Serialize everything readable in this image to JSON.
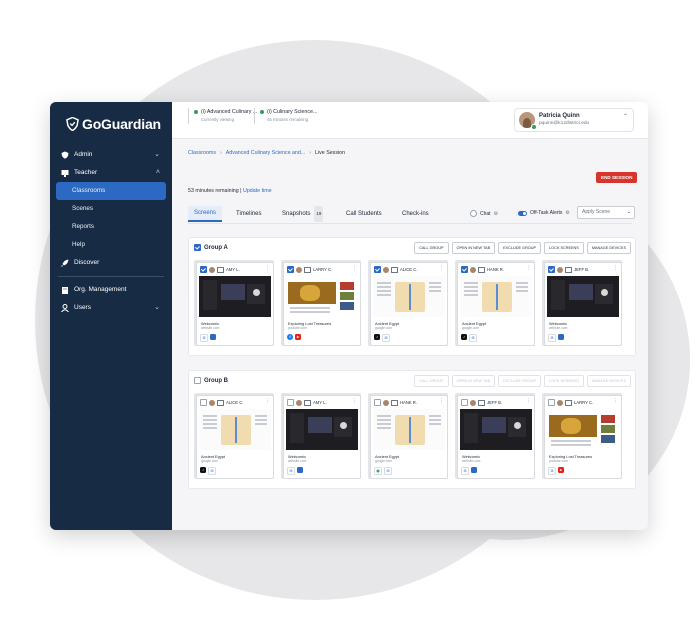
{
  "brand": {
    "logo_text": "GoGuardian"
  },
  "sidebar": {
    "items": [
      {
        "label": "Admin",
        "has_caret": true
      },
      {
        "label": "Teacher",
        "has_caret": true
      },
      {
        "label": "Classrooms",
        "active": true
      },
      {
        "label": "Scenes"
      },
      {
        "label": "Reports"
      },
      {
        "label": "Help"
      },
      {
        "label": "Discover"
      },
      {
        "label": "Org. Management"
      },
      {
        "label": "Users",
        "has_caret": true
      }
    ]
  },
  "topbar": {
    "sessions": [
      {
        "title": "(i) Advanced Culinary ...",
        "status": "Currently viewing"
      },
      {
        "title": "(i) Culinary Science...",
        "status": "45 minutes remaining"
      }
    ],
    "user": {
      "name": "Patricia Quinn",
      "email": "pquinn@k12district.edu"
    }
  },
  "breadcrumb": {
    "root": "Classrooms",
    "middle": "Advanced Culinary Science and...",
    "current": "Live Session"
  },
  "end_session_label": "END SESSION",
  "session": {
    "time_remaining": "53 minutes remaining",
    "separator": "|",
    "update_time_label": "Update time"
  },
  "view_tabs": [
    {
      "label": "Screens",
      "active": true
    },
    {
      "label": "Timelines"
    },
    {
      "label": "Snapshots",
      "count": "19"
    },
    {
      "label": "Call Students"
    },
    {
      "label": "Check-ins"
    }
  ],
  "controls": {
    "chat_label": "Chat",
    "offtask_label": "Off-Task Alerts",
    "apply_scene_placeholder": "Apply Scene"
  },
  "group_a": {
    "title": "Group A",
    "actions": [
      "CALL GROUP",
      "OPEN IN NEW TAB",
      "EXCLUDE GROUP",
      "LOCK SCREENS",
      "MANAGE DEVICES"
    ],
    "cards": [
      {
        "name": "AMY L.",
        "page_title": "Webcomic",
        "url": "website.com",
        "theme": "dark",
        "apps": [
          "google",
          "meet"
        ]
      },
      {
        "name": "LARRY C.",
        "page_title": "Exploring Lost Treasures",
        "url": "youtube.com",
        "theme": "gold",
        "apps": [
          "fb",
          "yt"
        ]
      },
      {
        "name": "ALICE C.",
        "page_title": "Ancient Egypt",
        "url": "google.com",
        "theme": "map",
        "apps": [
          "tiktok",
          "google"
        ]
      },
      {
        "name": "HANK R.",
        "page_title": "Ancient Egypt",
        "url": "google.com",
        "theme": "map",
        "apps": [
          "tiktok",
          "google"
        ]
      },
      {
        "name": "JEFF B.",
        "page_title": "Webcomic",
        "url": "website.com",
        "theme": "dark",
        "apps": [
          "google",
          "meet"
        ]
      }
    ]
  },
  "group_b": {
    "title": "Group B",
    "actions": [
      "CALL GROUP",
      "OPEN IN NEW TAB",
      "EXCLUDE GROUP",
      "LOCK SCREENS",
      "MANAGE DEVICES"
    ],
    "cards": [
      {
        "name": "ALICE C.",
        "page_title": "Ancient Egypt",
        "url": "google.com",
        "theme": "map",
        "apps": [
          "tiktok",
          "google"
        ]
      },
      {
        "name": "AMY L.",
        "page_title": "Webcomic",
        "url": "website.com",
        "theme": "dark",
        "apps": [
          "google",
          "meet"
        ]
      },
      {
        "name": "HANK R.",
        "page_title": "Ancient Egypt",
        "url": "google.com",
        "theme": "map",
        "apps": [
          "chrome",
          "google"
        ]
      },
      {
        "name": "JEFF B.",
        "page_title": "Webcomic",
        "url": "website.com",
        "theme": "dark",
        "apps": [
          "google",
          "meet"
        ]
      },
      {
        "name": "LARRY C.",
        "page_title": "Exploring Lost Treasures",
        "url": "youtube.com",
        "theme": "gold",
        "apps": [
          "google",
          "yt"
        ]
      }
    ]
  },
  "colors": {
    "sidebar_bg": "#172b44",
    "accent": "#2c69c3",
    "danger": "#d6342c",
    "online": "#2e9e5b"
  }
}
